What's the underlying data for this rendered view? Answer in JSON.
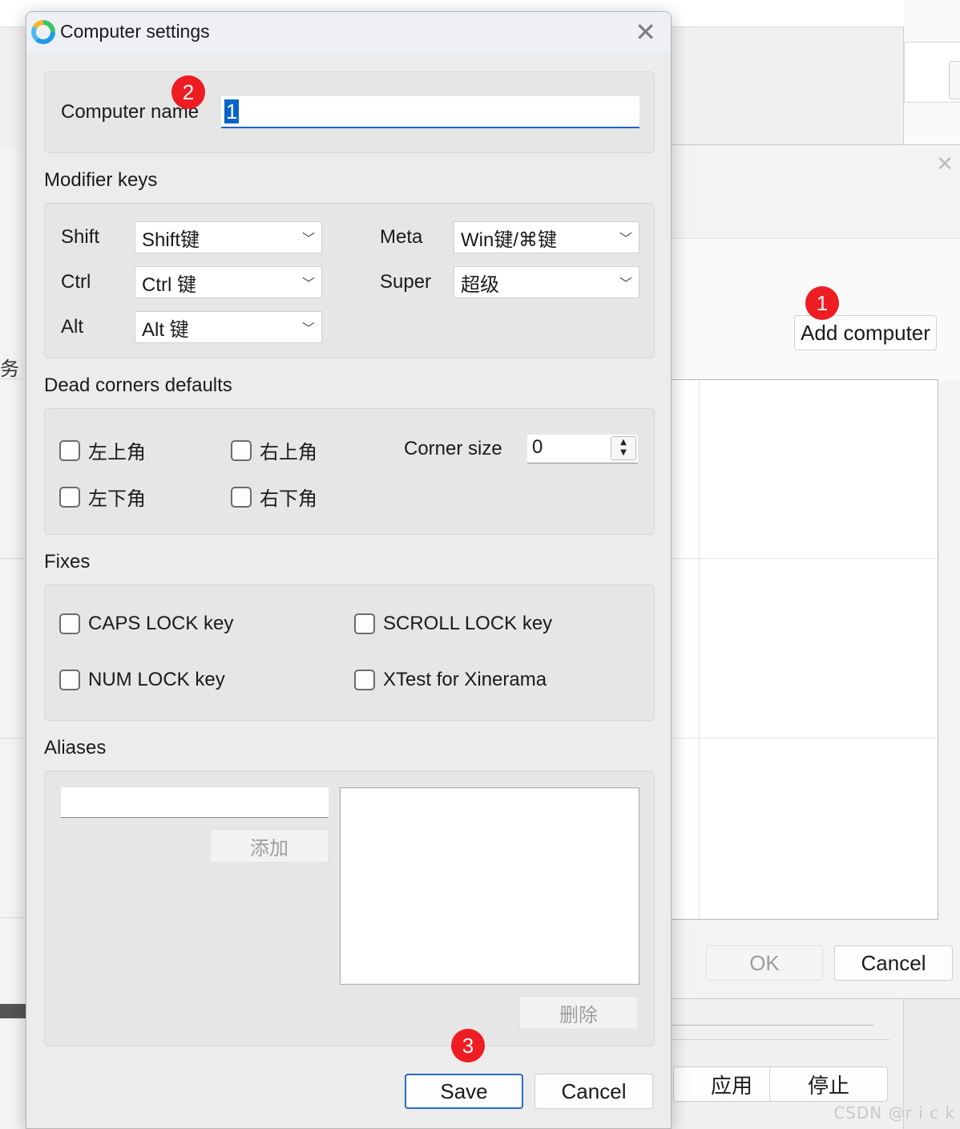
{
  "dialog": {
    "title": "Computer settings",
    "computer_name_label": "Computer name",
    "computer_name_value": "1",
    "modifier_keys": {
      "section": "Modifier keys",
      "shift": {
        "label": "Shift",
        "value": "Shift键"
      },
      "ctrl": {
        "label": "Ctrl",
        "value": "Ctrl 键"
      },
      "alt": {
        "label": "Alt",
        "value": "Alt 键"
      },
      "meta": {
        "label": "Meta",
        "value": "Win键/⌘键"
      },
      "super": {
        "label": "Super",
        "value": "超级"
      }
    },
    "dead_corners": {
      "section": "Dead corners defaults",
      "top_left": "左上角",
      "top_right": "右上角",
      "bottom_left": "左下角",
      "bottom_right": "右下角",
      "corner_size_label": "Corner size",
      "corner_size_value": "0"
    },
    "fixes": {
      "section": "Fixes",
      "caps_lock": "CAPS LOCK key",
      "scroll_lock": "SCROLL LOCK key",
      "num_lock": "NUM LOCK key",
      "xtest": "XTest for Xinerama"
    },
    "aliases": {
      "section": "Aliases",
      "add_label": "添加",
      "delete_label": "删除"
    },
    "save_label": "Save",
    "cancel_label": "Cancel"
  },
  "background": {
    "add_computer_label": "Add computer",
    "ok_label": "OK",
    "cancel_label": "Cancel",
    "apply_label": "应用",
    "stop_label": "停止",
    "left_fragment": "务",
    "watermark": "CSDN @r i c k"
  },
  "badges": {
    "one": "1",
    "two": "2",
    "three": "3"
  },
  "colors": {
    "badge": "#ee1d23",
    "accent": "#2063c4"
  }
}
